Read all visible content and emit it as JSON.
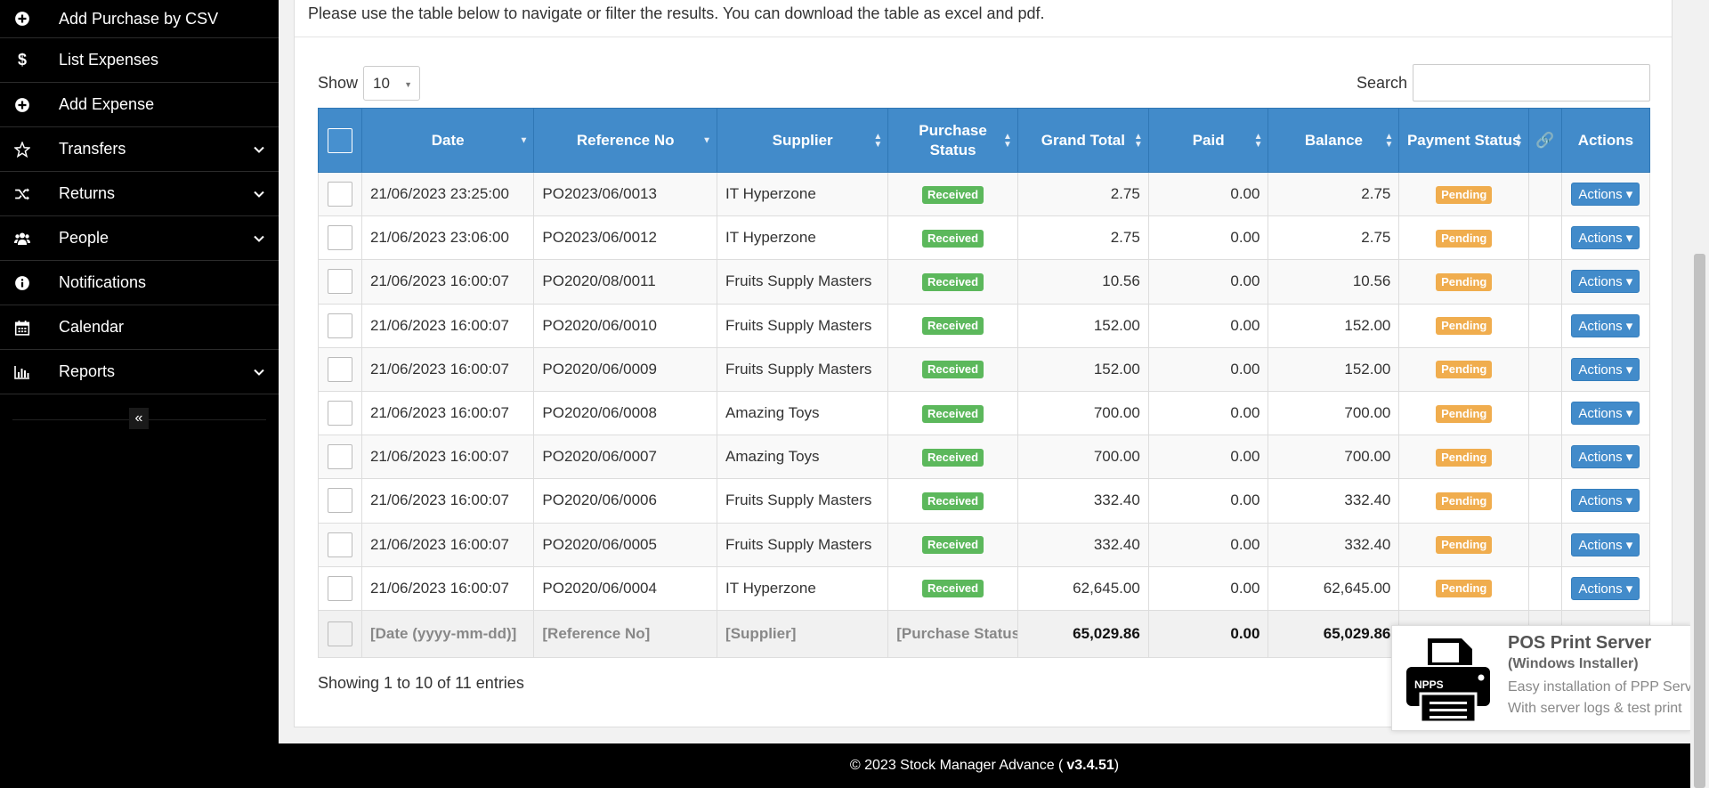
{
  "sidebar": {
    "items": [
      {
        "label": "Add Purchase by CSV",
        "icon": "plus-circle-icon"
      },
      {
        "label": "List Expenses",
        "icon": "dollar-icon"
      },
      {
        "label": "Add Expense",
        "icon": "plus-circle-icon"
      },
      {
        "label": "Transfers",
        "icon": "star-icon",
        "has_submenu": true
      },
      {
        "label": "Returns",
        "icon": "random-icon",
        "has_submenu": true
      },
      {
        "label": "People",
        "icon": "users-icon",
        "has_submenu": true
      },
      {
        "label": "Notifications",
        "icon": "info-circle-icon"
      },
      {
        "label": "Calendar",
        "icon": "calendar-icon"
      },
      {
        "label": "Reports",
        "icon": "bar-chart-icon",
        "has_submenu": true
      }
    ],
    "collapse_glyph": "«"
  },
  "intro_text": "Please use the table below to navigate or filter the results. You can download the table as excel and pdf.",
  "controls": {
    "show_label": "Show",
    "show_value": "10",
    "search_label": "Search",
    "search_value": ""
  },
  "table": {
    "headers": [
      "Date",
      "Reference No",
      "Supplier",
      "Purchase Status",
      "Grand Total",
      "Paid",
      "Balance",
      "Payment Status",
      "",
      "Actions"
    ],
    "rows": [
      {
        "date": "21/06/2023 23:25:00",
        "ref": "PO2023/06/0013",
        "supplier": "IT Hyperzone",
        "status": "Received",
        "total": "2.75",
        "paid": "0.00",
        "balance": "2.75",
        "payment": "Pending",
        "action": "Actions"
      },
      {
        "date": "21/06/2023 23:06:00",
        "ref": "PO2023/06/0012",
        "supplier": "IT Hyperzone",
        "status": "Received",
        "total": "2.75",
        "paid": "0.00",
        "balance": "2.75",
        "payment": "Pending",
        "action": "Actions"
      },
      {
        "date": "21/06/2023 16:00:07",
        "ref": "PO2020/08/0011",
        "supplier": "Fruits Supply Masters",
        "status": "Received",
        "total": "10.56",
        "paid": "0.00",
        "balance": "10.56",
        "payment": "Pending",
        "action": "Actions"
      },
      {
        "date": "21/06/2023 16:00:07",
        "ref": "PO2020/06/0010",
        "supplier": "Fruits Supply Masters",
        "status": "Received",
        "total": "152.00",
        "paid": "0.00",
        "balance": "152.00",
        "payment": "Pending",
        "action": "Actions"
      },
      {
        "date": "21/06/2023 16:00:07",
        "ref": "PO2020/06/0009",
        "supplier": "Fruits Supply Masters",
        "status": "Received",
        "total": "152.00",
        "paid": "0.00",
        "balance": "152.00",
        "payment": "Pending",
        "action": "Actions"
      },
      {
        "date": "21/06/2023 16:00:07",
        "ref": "PO2020/06/0008",
        "supplier": "Amazing Toys",
        "status": "Received",
        "total": "700.00",
        "paid": "0.00",
        "balance": "700.00",
        "payment": "Pending",
        "action": "Actions"
      },
      {
        "date": "21/06/2023 16:00:07",
        "ref": "PO2020/06/0007",
        "supplier": "Amazing Toys",
        "status": "Received",
        "total": "700.00",
        "paid": "0.00",
        "balance": "700.00",
        "payment": "Pending",
        "action": "Actions"
      },
      {
        "date": "21/06/2023 16:00:07",
        "ref": "PO2020/06/0006",
        "supplier": "Fruits Supply Masters",
        "status": "Received",
        "total": "332.40",
        "paid": "0.00",
        "balance": "332.40",
        "payment": "Pending",
        "action": "Actions"
      },
      {
        "date": "21/06/2023 16:00:07",
        "ref": "PO2020/06/0005",
        "supplier": "Fruits Supply Masters",
        "status": "Received",
        "total": "332.40",
        "paid": "0.00",
        "balance": "332.40",
        "payment": "Pending",
        "action": "Actions"
      },
      {
        "date": "21/06/2023 16:00:07",
        "ref": "PO2020/06/0004",
        "supplier": "IT Hyperzone",
        "status": "Received",
        "total": "62,645.00",
        "paid": "0.00",
        "balance": "62,645.00",
        "payment": "Pending",
        "action": "Actions"
      }
    ],
    "footer": {
      "date": "[Date (yyyy-mm-dd)]",
      "ref": "[Reference No]",
      "supplier": "[Supplier]",
      "status": "[Purchase Status]",
      "total": "65,029.86",
      "paid": "0.00",
      "balance": "65,029.86"
    }
  },
  "info_text": "Showing 1 to 10 of 11 entries",
  "pos_popup": {
    "title": "POS Print Server",
    "subtitle": "(Windows Installer)",
    "line1": "Easy installation of PPP Server",
    "line2": "With server logs & test print",
    "icon_text": "NPPS"
  },
  "footer": {
    "text": "© 2023 Stock Manager Advance (",
    "version": "v3.4.51",
    "close": " )"
  },
  "colors": {
    "header_blue": "#428bca",
    "success": "#5cb85c",
    "warning": "#f0ad4e",
    "sidebar_bg": "#000000"
  }
}
